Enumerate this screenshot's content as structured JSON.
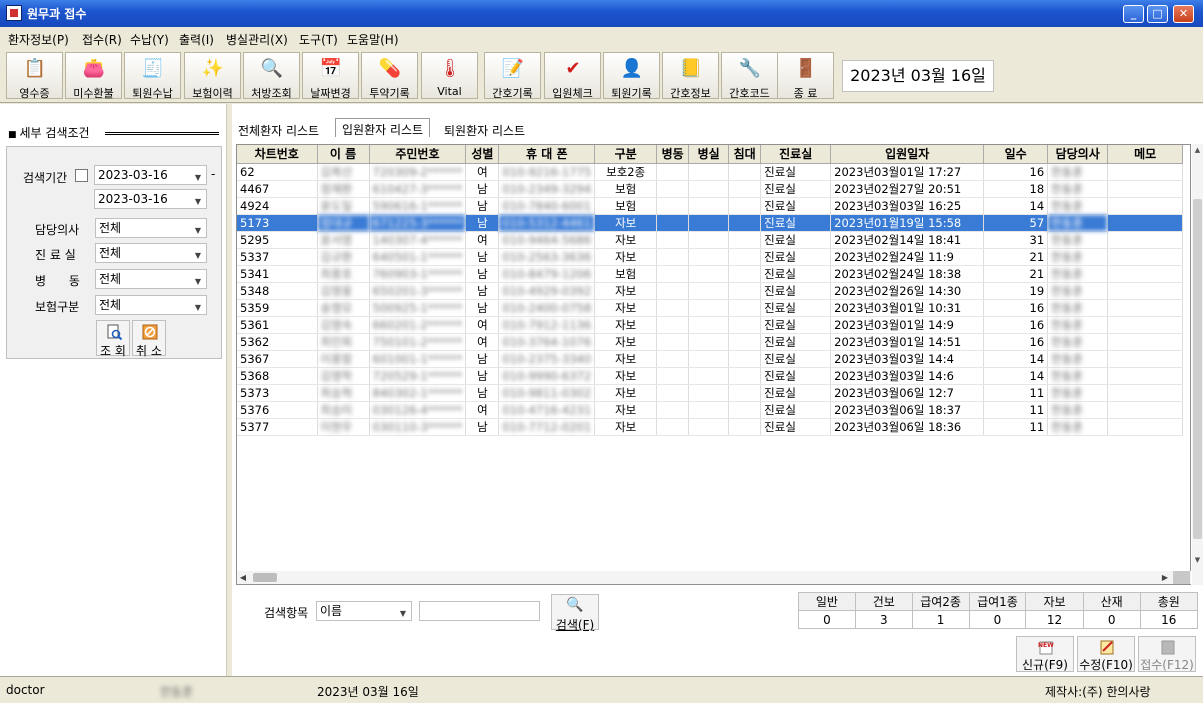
{
  "window": {
    "title": "원무과 접수"
  },
  "menu": [
    "환자정보(P)",
    "접수(R)",
    "수납(Y)",
    "출력(I)",
    "병실관리(X)",
    "도구(T)",
    "도움말(H)"
  ],
  "toolbar": [
    {
      "label": "영수증",
      "icon": "receipt-icon"
    },
    {
      "label": "미수환불",
      "icon": "refund-icon"
    },
    {
      "label": "퇴원수납",
      "icon": "discharge-payment-icon"
    },
    {
      "label": "보험이력",
      "icon": "insurance-history-icon"
    },
    {
      "label": "처방조회",
      "icon": "search-icon"
    },
    {
      "label": "날짜변경",
      "icon": "calendar-icon"
    },
    {
      "label": "투약기록",
      "icon": "medication-icon"
    },
    {
      "label": "Vital",
      "icon": "thermometer-icon"
    },
    {
      "label": "간호기록",
      "icon": "nursing-record-icon"
    },
    {
      "label": "입원체크",
      "icon": "check-icon"
    },
    {
      "label": "퇴원기록",
      "icon": "discharge-record-icon"
    },
    {
      "label": "간호정보",
      "icon": "nursing-info-icon"
    },
    {
      "label": "간호코드",
      "icon": "tools-icon"
    },
    {
      "label": "종   료",
      "icon": "exit-door-icon"
    }
  ],
  "current_date": "2023년  03월  16일",
  "filter": {
    "heading": "세부 검색조건",
    "period_label": "검색기간",
    "date_from": "2023-03-16",
    "date_sep": "-",
    "date_to": "2023-03-16",
    "doctor_label": "담당의사",
    "doctor_value": "전체",
    "clinic_label": "진 료 실",
    "clinic_value": "전체",
    "ward_label": "병      동",
    "ward_value": "전체",
    "insurance_label": "보험구분",
    "insurance_value": "전체",
    "search_button": "조 회",
    "cancel_button": "취 소"
  },
  "tabs": [
    "전체환자 리스트",
    "입원환자 리스트",
    "퇴원환자 리스트"
  ],
  "table": {
    "columns": [
      "차트번호",
      "이  름",
      "주민번호",
      "성별",
      "휴 대 폰",
      "구분",
      "병동",
      "병실",
      "침대",
      "진료실",
      "입원일자",
      "일수",
      "담당의사",
      "메모"
    ],
    "rows": [
      [
        "62",
        "김복선",
        "720309-2******",
        "여",
        "010-9216-1775",
        "보호2종",
        "",
        "",
        "",
        "진료실",
        "2023년03월01일  17:27",
        "16",
        "한동훈",
        ""
      ],
      [
        "4467",
        "정재환",
        "610427-3******",
        "남",
        "010-2349-3294",
        "보험",
        "",
        "",
        "",
        "진료실",
        "2023년02월27일  20:51",
        "18",
        "한동훈",
        ""
      ],
      [
        "4924",
        "윤도일",
        "590616-1******",
        "남",
        "010-7840-6001",
        "보험",
        "",
        "",
        "",
        "진료실",
        "2023년03월03일  16:25",
        "14",
        "한동훈",
        ""
      ],
      [
        "5173",
        "정대규",
        "671225-3******",
        "남",
        "010-5312-4461",
        "자보",
        "",
        "",
        "",
        "진료실",
        "2023년01월19일  15:58",
        "57",
        "한동훈",
        ""
      ],
      [
        "5295",
        "윤서영",
        "140307-4******",
        "여",
        "010-9464-5686",
        "자보",
        "",
        "",
        "",
        "진료실",
        "2023년02월14일  18:41",
        "31",
        "한동훈",
        ""
      ],
      [
        "5337",
        "김규환",
        "640501-1******",
        "남",
        "010-2563-3636",
        "자보",
        "",
        "",
        "",
        "진료실",
        "2023년02월24일  11:9",
        "21",
        "한동훈",
        ""
      ],
      [
        "5341",
        "최용호",
        "760903-1******",
        "남",
        "010-8479-1206",
        "보험",
        "",
        "",
        "",
        "진료실",
        "2023년02월24일  18:38",
        "21",
        "한동훈",
        ""
      ],
      [
        "5348",
        "김영웅",
        "650201-3******",
        "남",
        "010-4929-0392",
        "자보",
        "",
        "",
        "",
        "진료실",
        "2023년02월26일  14:30",
        "19",
        "한동훈",
        ""
      ],
      [
        "5359",
        "송명모",
        "500925-1******",
        "남",
        "010-2400-0758",
        "자보",
        "",
        "",
        "",
        "진료실",
        "2023년03월01일  10:31",
        "16",
        "한동훈",
        ""
      ],
      [
        "5361",
        "김영숙",
        "660201-2******",
        "여",
        "010-7912-1136",
        "자보",
        "",
        "",
        "",
        "진료실",
        "2023년03월01일  14:9",
        "16",
        "한동훈",
        ""
      ],
      [
        "5362",
        "최민희",
        "750101-2******",
        "여",
        "010-3764-1076",
        "자보",
        "",
        "",
        "",
        "진료실",
        "2023년03월01일  14:51",
        "16",
        "한동훈",
        ""
      ],
      [
        "5367",
        "이용함",
        "601001-1******",
        "남",
        "010-2375-3340",
        "자보",
        "",
        "",
        "",
        "진료실",
        "2023년03월03일  14:4",
        "14",
        "한동훈",
        ""
      ],
      [
        "5368",
        "김영학",
        "720529-1******",
        "남",
        "010-9990-6372",
        "자보",
        "",
        "",
        "",
        "진료실",
        "2023년03월03일  14:6",
        "14",
        "한동훈",
        ""
      ],
      [
        "5373",
        "최승혁",
        "840302-1******",
        "남",
        "010-9811-0302",
        "자보",
        "",
        "",
        "",
        "진료실",
        "2023년03월06일  12:7",
        "11",
        "한동훈",
        ""
      ],
      [
        "5376",
        "최승미",
        "030126-4******",
        "여",
        "010-4716-4231",
        "자보",
        "",
        "",
        "",
        "진료실",
        "2023년03월06일  18:37",
        "11",
        "한동훈",
        ""
      ],
      [
        "5377",
        "이현우",
        "030110-3******",
        "남",
        "010-7712-0201",
        "자보",
        "",
        "",
        "",
        "진료실",
        "2023년03월06일  18:36",
        "11",
        "한동훈",
        ""
      ]
    ],
    "selected_row": 3
  },
  "search": {
    "label": "검색항목",
    "field_value": "이름",
    "query_value": "",
    "button": "검색(F)"
  },
  "counts": {
    "headers": [
      "일반",
      "건보",
      "급여2종",
      "급여1종",
      "자보",
      "산재",
      "총원"
    ],
    "values": [
      "0",
      "3",
      "1",
      "0",
      "12",
      "0",
      "16"
    ]
  },
  "actions": {
    "new": "신규(F9)",
    "edit": "수정(F10)",
    "register": "접수(F12)"
  },
  "status": {
    "user": "doctor",
    "doctor_name": "한동훈",
    "date": "2023년 03월 16일",
    "maker": "제작사:(주) 한의사랑"
  },
  "colors": {
    "titlebar": "#1d56cf",
    "selection": "#3a7bd5",
    "chrome": "#ece9d8"
  }
}
